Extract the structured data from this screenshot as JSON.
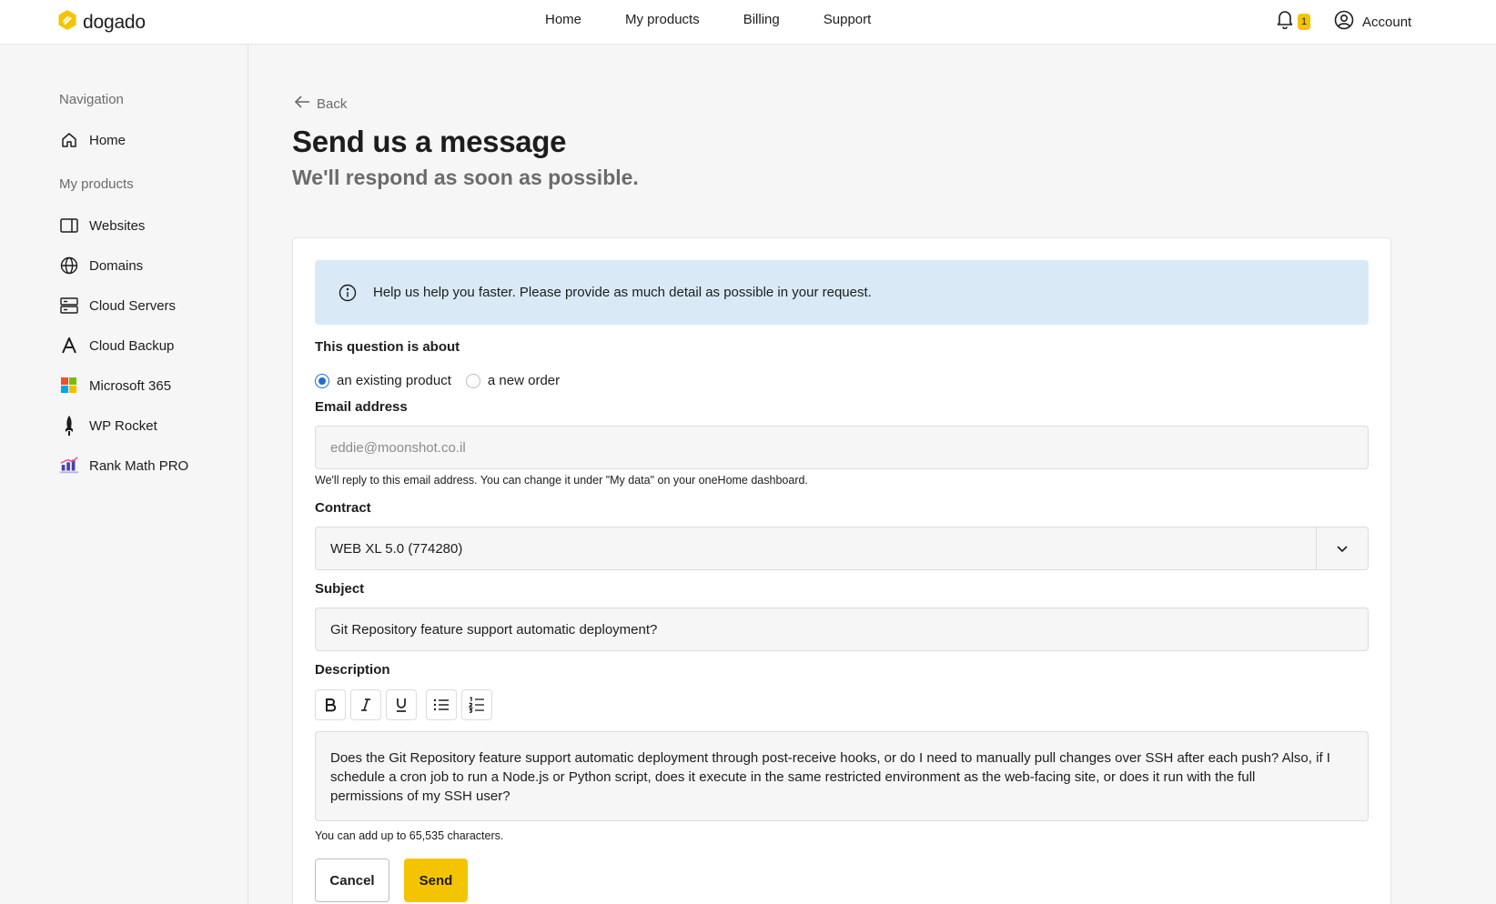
{
  "header": {
    "brand": "dogado",
    "nav": [
      "Home",
      "My products",
      "Billing",
      "Support"
    ],
    "notification_count": "1",
    "account_label": "Account",
    "accent_color": "#f5c400"
  },
  "sidebar": {
    "heading_navigation": "Navigation",
    "home_label": "Home",
    "heading_products": "My products",
    "products": [
      {
        "label": "Websites",
        "icon": "browser-window-icon"
      },
      {
        "label": "Domains",
        "icon": "globe-icon"
      },
      {
        "label": "Cloud Servers",
        "icon": "server-icon"
      },
      {
        "label": "Cloud Backup",
        "icon": "acronis-logo-icon"
      },
      {
        "label": "Microsoft 365",
        "icon": "microsoft-logo-icon"
      },
      {
        "label": "WP Rocket",
        "icon": "wp-rocket-logo-icon"
      },
      {
        "label": "Rank Math PRO",
        "icon": "rank-math-logo-icon"
      }
    ]
  },
  "page": {
    "back_label": "Back",
    "title": "Send us a message",
    "subtitle": "We'll respond as soon as possible."
  },
  "form": {
    "info_text": "Help us help you faster. Please provide as much detail as possible in your request.",
    "question_label": "This question is about",
    "radio_options": [
      {
        "label": "an existing product",
        "selected": true
      },
      {
        "label": "a new order",
        "selected": false
      }
    ],
    "email_label": "Email address",
    "email_value": "eddie@moonshot.co.il",
    "email_hint": "We'll reply to this email address. You can change it under \"My data\" on your oneHome dashboard.",
    "contract_label": "Contract",
    "contract_value": "WEB XL 5.0 (774280)",
    "subject_label": "Subject",
    "subject_value": "Git Repository feature support automatic deployment?",
    "description_label": "Description",
    "description_value": "Does the Git Repository feature support automatic deployment through post-receive hooks, or do I need to manually pull changes over SSH after each push? Also, if I schedule a cron job to run a Node.js or Python script, does it execute in the same restricted environment as the web-facing site, or does it run with the full permissions of my SSH user?",
    "char_limit_hint": "You can add up to 65,535 characters.",
    "cancel_label": "Cancel",
    "send_label": "Send"
  }
}
